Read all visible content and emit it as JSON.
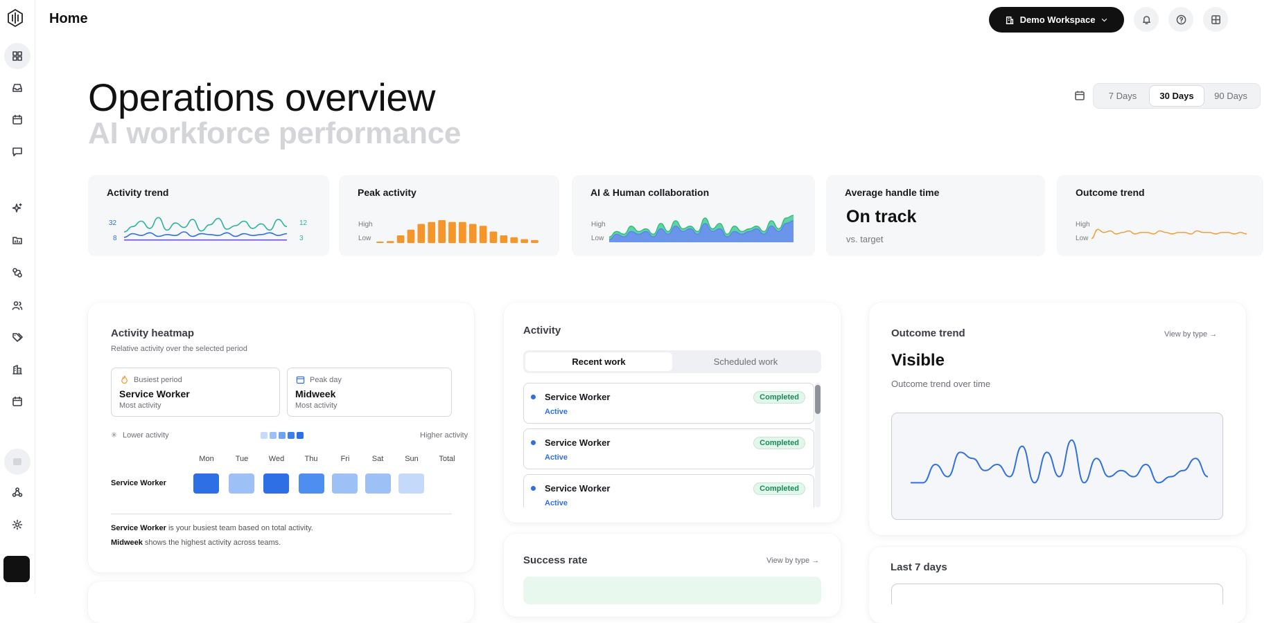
{
  "topbar": {
    "title": "Home",
    "workspace_label": "Demo Workspace"
  },
  "hero": {
    "title": "Operations overview",
    "subtitle": "AI workforce performance"
  },
  "range": {
    "options": [
      "7 Days",
      "30 Days",
      "90 Days"
    ],
    "selected": "30 Days"
  },
  "kpis": {
    "activity_trend": {
      "title": "Activity trend",
      "left_top": "32",
      "left_bottom": "8",
      "right_top": "12",
      "right_bottom": "3"
    },
    "peak_activity": {
      "title": "Peak activity",
      "high": "High",
      "low": "Low"
    },
    "collaboration": {
      "title": "AI & Human collaboration",
      "high": "High",
      "low": "Low"
    },
    "handle_time": {
      "title": "Average handle time",
      "value": "On track",
      "caption": "vs. target"
    },
    "outcome_trend": {
      "title": "Outcome trend",
      "high": "High",
      "low": "Low"
    }
  },
  "heatmap": {
    "title": "Activity heatmap",
    "subtitle": "Relative activity over the selected period",
    "busiest": {
      "label": "Busiest period",
      "value": "Service Worker",
      "sub": "Most activity"
    },
    "peak_day": {
      "label": "Peak day",
      "value": "Midweek",
      "sub": "Most activity"
    },
    "lower": "Lower activity",
    "higher": "Higher activity",
    "days": [
      "Mon",
      "Tue",
      "Wed",
      "Thu",
      "Fri",
      "Sat",
      "Sun",
      "Total"
    ],
    "row_label": "Service Worker",
    "levels": [
      5,
      2,
      5,
      4,
      2,
      2,
      1
    ],
    "note1_bold": "Service Worker",
    "note1_rest": " is your busiest team based on total activity.",
    "note2_bold": "Midweek",
    "note2_rest": " shows the highest activity across teams."
  },
  "activity": {
    "title": "Activity",
    "tabs": [
      "Recent work",
      "Scheduled work"
    ],
    "rows": [
      {
        "name": "Service Worker",
        "status": "Active",
        "badge": "Completed"
      },
      {
        "name": "Service Worker",
        "status": "Active",
        "badge": "Completed"
      },
      {
        "name": "Service Worker",
        "status": "Active",
        "badge": "Completed"
      }
    ]
  },
  "success_rate": {
    "title": "Success rate",
    "link": "View by type →"
  },
  "outcome_card": {
    "title": "Outcome trend",
    "link": "View by type →",
    "value": "Visible",
    "caption": "Outcome trend over time"
  },
  "last7": {
    "title": "Last 7 days"
  },
  "colors": {
    "accent_blue": "#2f6fe0",
    "orange": "#f5962a",
    "teal": "#2bb3a0",
    "purple": "#6a4cf0",
    "green_badge": "#178a55"
  },
  "chart_data": [
    {
      "type": "line",
      "title": "Activity trend",
      "series": [
        {
          "values": [
            10,
            16,
            22,
            14,
            26,
            12,
            20,
            15,
            24,
            11,
            18,
            25,
            13,
            17,
            22,
            14,
            19,
            12,
            24,
            16
          ]
        },
        {
          "values": [
            4,
            8,
            6,
            9,
            5,
            7,
            6,
            10,
            5,
            8,
            7,
            6,
            9,
            5,
            8,
            6,
            7,
            9,
            6,
            8
          ]
        },
        {
          "values": [
            1,
            1,
            1,
            1,
            1,
            1,
            1,
            1,
            1,
            1,
            1,
            1,
            1,
            1,
            1,
            1,
            1,
            1,
            1,
            1
          ]
        }
      ]
    },
    {
      "type": "bar",
      "title": "Peak activity",
      "values": [
        0.5,
        1,
        4,
        7,
        10,
        11,
        12,
        11,
        11,
        10,
        9,
        6,
        4,
        3,
        2,
        1.5
      ]
    },
    {
      "type": "area",
      "title": "AI & Human collaboration",
      "series": [
        {
          "values": [
            2,
            4,
            3,
            6,
            4,
            5,
            3,
            7,
            4,
            8,
            5,
            6,
            4,
            9,
            5,
            7,
            3,
            6,
            4,
            5,
            6,
            4,
            8,
            5,
            9,
            10
          ]
        },
        {
          "values": [
            1,
            3,
            2,
            4,
            3,
            4,
            2,
            5,
            3,
            6,
            4,
            5,
            3,
            7,
            4,
            5,
            2,
            4,
            3,
            4,
            5,
            3,
            6,
            4,
            7,
            8
          ]
        }
      ]
    },
    {
      "type": "line",
      "title": "Outcome trend",
      "values": [
        2,
        8,
        6,
        7,
        5,
        6,
        7,
        5,
        6,
        6,
        5,
        7,
        6,
        5,
        6,
        6,
        5,
        7,
        6,
        6,
        5,
        6,
        6,
        5,
        6,
        5
      ]
    },
    {
      "type": "line",
      "title": "Outcome trend",
      "values": [
        2,
        2,
        5,
        3,
        7,
        6,
        4,
        5,
        3,
        8,
        2,
        7,
        3,
        9,
        2,
        6,
        3,
        4,
        3,
        5,
        2,
        3,
        4,
        6,
        3
      ]
    }
  ]
}
